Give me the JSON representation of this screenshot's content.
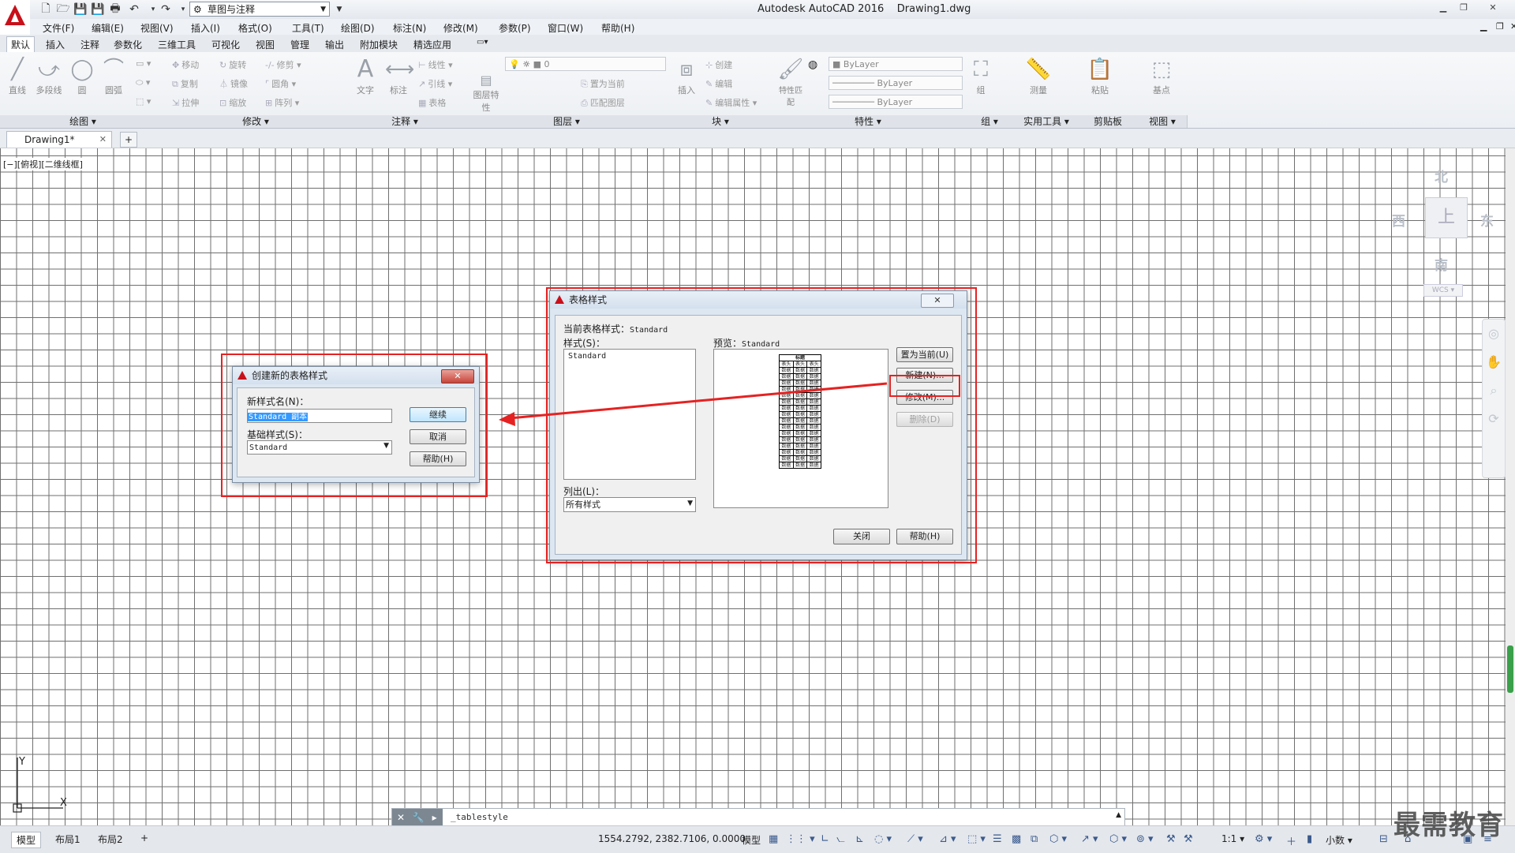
{
  "app": {
    "title": "Autodesk AutoCAD 2016",
    "document": "Drawing1.dwg",
    "workspace": "草图与注释"
  },
  "menu": [
    "文件(F)",
    "编辑(E)",
    "视图(V)",
    "插入(I)",
    "格式(O)",
    "工具(T)",
    "绘图(D)",
    "标注(N)",
    "修改(M)",
    "参数(P)",
    "窗口(W)",
    "帮助(H)"
  ],
  "ribbon_tabs": [
    "默认",
    "插入",
    "注释",
    "参数化",
    "三维工具",
    "可视化",
    "视图",
    "管理",
    "输出",
    "附加模块",
    "精选应用"
  ],
  "ribbon": {
    "draw": {
      "title": "绘图",
      "line": "直线",
      "polyline": "多段线",
      "circle": "圆",
      "arc": "圆弧"
    },
    "modify": {
      "title": "修改",
      "move": "移动",
      "rotate": "旋转",
      "trim": "修剪",
      "copy": "复制",
      "mirror": "镜像",
      "fillet": "圆角",
      "stretch": "拉伸",
      "scale": "缩放",
      "array": "阵列"
    },
    "annotation": {
      "title": "注释",
      "text": "文字",
      "dimension": "标注",
      "linear": "线性",
      "leader": "引线",
      "table": "表格"
    },
    "layers": {
      "title": "图层",
      "layer_props": "图层特性",
      "layer_value": "0",
      "make_current": "置为当前",
      "match": "匹配图层"
    },
    "block": {
      "title": "块",
      "insert": "插入",
      "create": "创建",
      "edit": "编辑",
      "edit_attr": "编辑属性"
    },
    "properties": {
      "title": "特性",
      "match": "特性匹配",
      "color": "ByLayer",
      "linetype": "ByLayer",
      "lineweight": "ByLayer"
    },
    "groups": {
      "title": "组",
      "group": "组"
    },
    "utilities": {
      "title": "实用工具",
      "measure": "测量"
    },
    "clipboard": {
      "title": "剪贴板",
      "paste": "粘贴"
    },
    "view": {
      "title": "视图",
      "base": "基点"
    }
  },
  "doc_tab": "Drawing1*",
  "viewport_label": "[−][俯视][二维线框]",
  "viewcube": {
    "north": "北",
    "south": "南",
    "east": "东",
    "west": "西",
    "top": "上",
    "wcs": "WCS"
  },
  "ucs": {
    "x": "X",
    "y": "Y"
  },
  "table_style_dialog": {
    "title": "表格样式",
    "current_label": "当前表格样式：",
    "current_value": "Standard",
    "styles_label": "样式(S)：",
    "styles": [
      "Standard"
    ],
    "preview_label": "预览：",
    "preview_value": "Standard",
    "preview_header": "标题",
    "preview_header_cells": [
      "表头",
      "表头",
      "表头"
    ],
    "preview_cell": "数据",
    "list_label": "列出(L)：",
    "list_value": "所有样式",
    "set_current": "置为当前(U)",
    "new": "新建(N)...",
    "modify": "修改(M)...",
    "delete": "删除(D)",
    "close": "关闭",
    "help": "帮助(H)"
  },
  "create_style_dialog": {
    "title": "创建新的表格样式",
    "name_label": "新样式名(N)：",
    "name_value": "Standard 副本",
    "base_label": "基础样式(S)：",
    "base_value": "Standard",
    "continue": "继续",
    "cancel": "取消",
    "help": "帮助(H)"
  },
  "command_line": "_tablestyle",
  "layout_tabs": [
    "模型",
    "布局1",
    "布局2"
  ],
  "status": {
    "coords": "1554.2792, 2382.7106, 0.0000",
    "model": "模型",
    "scale": "1:1",
    "units": "小数"
  },
  "watermark": "最需教育",
  "colors": {
    "highlight": "#e52222",
    "accent": "#c8101a",
    "grid": "#6f6f6f"
  }
}
